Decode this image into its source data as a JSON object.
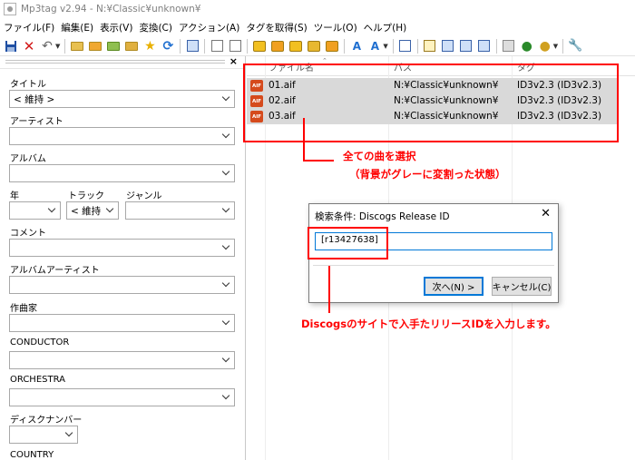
{
  "window": {
    "title": "Mp3tag v2.94  -  N:¥Classic¥unknown¥"
  },
  "menu": [
    "ファイル(F)",
    "編集(E)",
    "表示(V)",
    "変換(C)",
    "アクション(A)",
    "タグを取得(S)",
    "ツール(O)",
    "ヘルプ(H)"
  ],
  "toolbar": {
    "icons": [
      "save-icon",
      "delete-icon",
      "undo-icon",
      "open-folder-icon",
      "add-folder-icon",
      "playlist-icon",
      "favorites-icon",
      "star-icon",
      "refresh-icon",
      "list-icon",
      "tag-to-file-icon",
      "file-to-tag-icon",
      "convert-icon",
      "actions-icon",
      "case-icon",
      "edit-icon",
      "export-icon",
      "web-icon",
      "settings-icon"
    ]
  },
  "tag_panel": {
    "close": "×",
    "fields": {
      "title": {
        "label": "タイトル",
        "value": "< 維持 >"
      },
      "artist": {
        "label": "アーティスト",
        "value": ""
      },
      "album": {
        "label": "アルバム",
        "value": ""
      },
      "year": {
        "label": "年",
        "value": ""
      },
      "track": {
        "label": "トラック",
        "value": "< 維持"
      },
      "genre": {
        "label": "ジャンル",
        "value": ""
      },
      "comment": {
        "label": "コメント",
        "value": ""
      },
      "album_artist": {
        "label": "アルバムアーティスト",
        "value": ""
      },
      "composer": {
        "label": "作曲家",
        "value": ""
      },
      "conductor": {
        "label": "CONDUCTOR",
        "value": ""
      },
      "orchestra": {
        "label": "ORCHESTRA",
        "value": ""
      },
      "disc_number": {
        "label": "ディスクナンバー",
        "value": ""
      },
      "country": {
        "label": "COUNTRY"
      }
    }
  },
  "file_list": {
    "columns": [
      "ファイル名",
      "パス",
      "タグ"
    ],
    "rows": [
      {
        "name": "01.aif",
        "path": "N:¥Classic¥unknown¥",
        "tag": "ID3v2.3 (ID3v2.3)"
      },
      {
        "name": "02.aif",
        "path": "N:¥Classic¥unknown¥",
        "tag": "ID3v2.3 (ID3v2.3)"
      },
      {
        "name": "03.aif",
        "path": "N:¥Classic¥unknown¥",
        "tag": "ID3v2.3 (ID3v2.3)"
      }
    ]
  },
  "annotations": {
    "select_all": "全ての曲を選択",
    "select_all_note": "（背景がグレーに変割った状態）",
    "enter_id": "Discogsのサイトで入手たリリースIDを入力します。"
  },
  "dialog": {
    "title": "検索条件: Discogs Release ID",
    "close": "✕",
    "input_value": "[r13427638]",
    "next_button": "次へ(N) >",
    "cancel_button": "キャンセル(C)"
  },
  "colors": {
    "annotation": "#ff0000",
    "selection": "#d9d9d9",
    "focus": "#0078d7"
  }
}
